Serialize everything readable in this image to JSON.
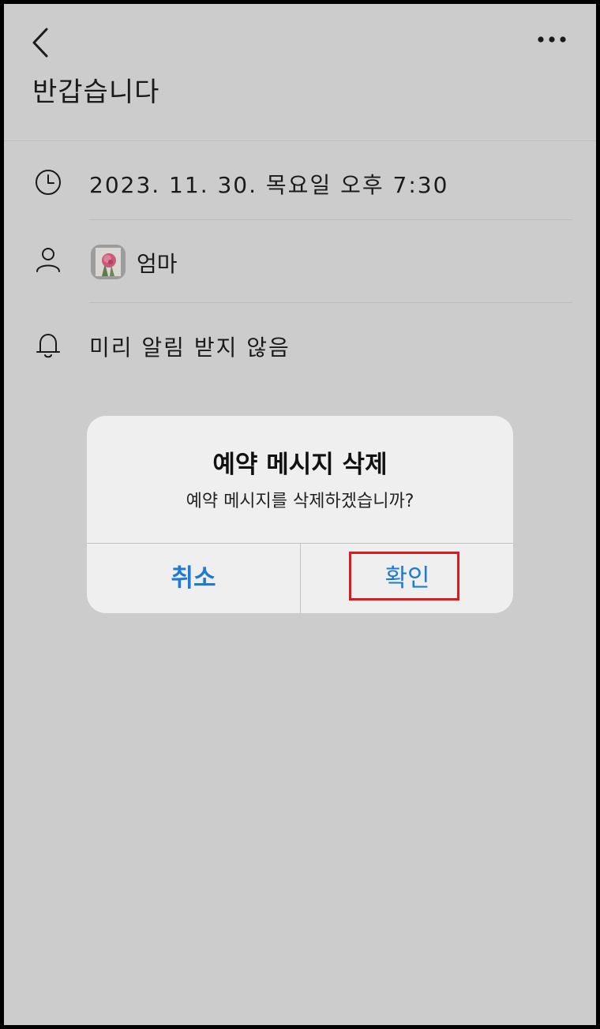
{
  "header": {
    "back_icon": "chevron-left-icon",
    "more_icon": "more-horizontal-icon",
    "title": "반갑습니다"
  },
  "details": {
    "datetime": {
      "icon": "clock-icon",
      "text": "2023. 11. 30. 목요일 오후 7:30"
    },
    "recipient": {
      "icon": "person-icon",
      "avatar": "rose-photo-avatar",
      "name": "엄마"
    },
    "reminder": {
      "icon": "bell-icon",
      "text": "미리 알림 받지 않음"
    }
  },
  "dialog": {
    "title": "예약 메시지 삭제",
    "message": "예약 메시지를 삭제하겠습니까?",
    "cancel_label": "취소",
    "confirm_label": "확인",
    "button_color": "#1f7bd0",
    "highlight_color": "#e0191f"
  },
  "colors": {
    "background": "#cccccc",
    "dialog_background": "#efefef",
    "frame": "#000000"
  }
}
